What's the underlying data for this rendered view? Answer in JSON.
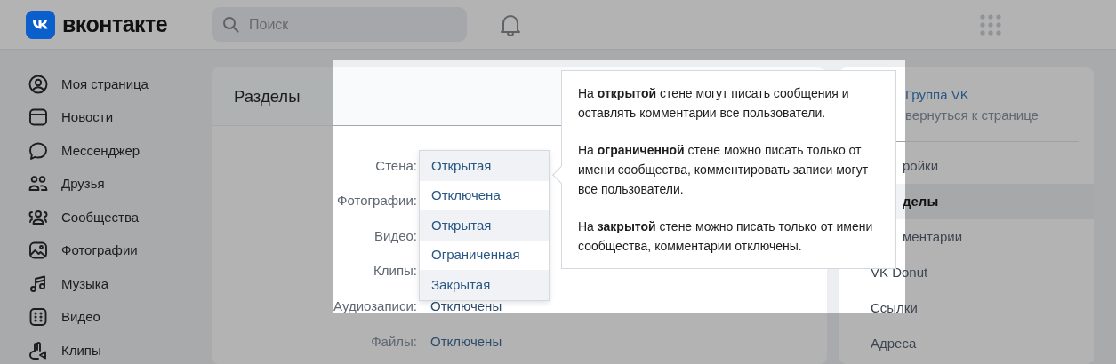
{
  "header": {
    "logo_text": "вконтакте",
    "search": {
      "placeholder": "Поиск"
    }
  },
  "nav": [
    {
      "label": "Моя страница",
      "kind": "profile"
    },
    {
      "label": "Новости",
      "kind": "news"
    },
    {
      "label": "Мессенджер",
      "kind": "messenger"
    },
    {
      "label": "Друзья",
      "kind": "friends"
    },
    {
      "label": "Сообщества",
      "kind": "communities"
    },
    {
      "label": "Фотографии",
      "kind": "photos"
    },
    {
      "label": "Музыка",
      "kind": "music"
    },
    {
      "label": "Видео",
      "kind": "video"
    },
    {
      "label": "Клипы",
      "kind": "clips"
    }
  ],
  "main": {
    "title": "Разделы",
    "rows": [
      {
        "label": "Стена:"
      },
      {
        "label": "Фотографии:"
      },
      {
        "label": "Видео:"
      },
      {
        "label": "Клипы:"
      },
      {
        "label": "Аудиозаписи:",
        "value": "Отключены"
      },
      {
        "label": "Файлы:",
        "value": "Отключены"
      }
    ],
    "dropdown": {
      "options": [
        {
          "label": "Открытая",
          "highlighted": true
        },
        {
          "label": "Отключена",
          "highlighted": false
        },
        {
          "label": "Открытая",
          "highlighted": true
        },
        {
          "label": "Ограниченная",
          "highlighted": false
        },
        {
          "label": "Закрытая",
          "highlighted": true
        }
      ]
    },
    "tooltip": {
      "paragraphs": [
        "На **открытой** стене могут писать сообщения и оставлять комментарии все пользователи.",
        "На **ограниченной** стене можно писать только от имени сообщества, комментировать записи могут все пользователи.",
        "На **закрытой** стене можно писать только от имени сообщества, комментарии отключены."
      ]
    }
  },
  "side": {
    "group_name": "Группа VK",
    "back_link": "вернуться к странице",
    "items": [
      {
        "label": "ройки",
        "selected": false,
        "covered": true
      },
      {
        "label": "делы",
        "selected": true,
        "covered": true
      },
      {
        "label": "ментарии",
        "selected": false,
        "covered": true
      },
      {
        "label": "VK Donut",
        "selected": false,
        "covered": false
      },
      {
        "label": "Ссылки",
        "selected": false,
        "covered": false
      },
      {
        "label": "Адреса",
        "selected": false,
        "covered": false
      }
    ]
  }
}
